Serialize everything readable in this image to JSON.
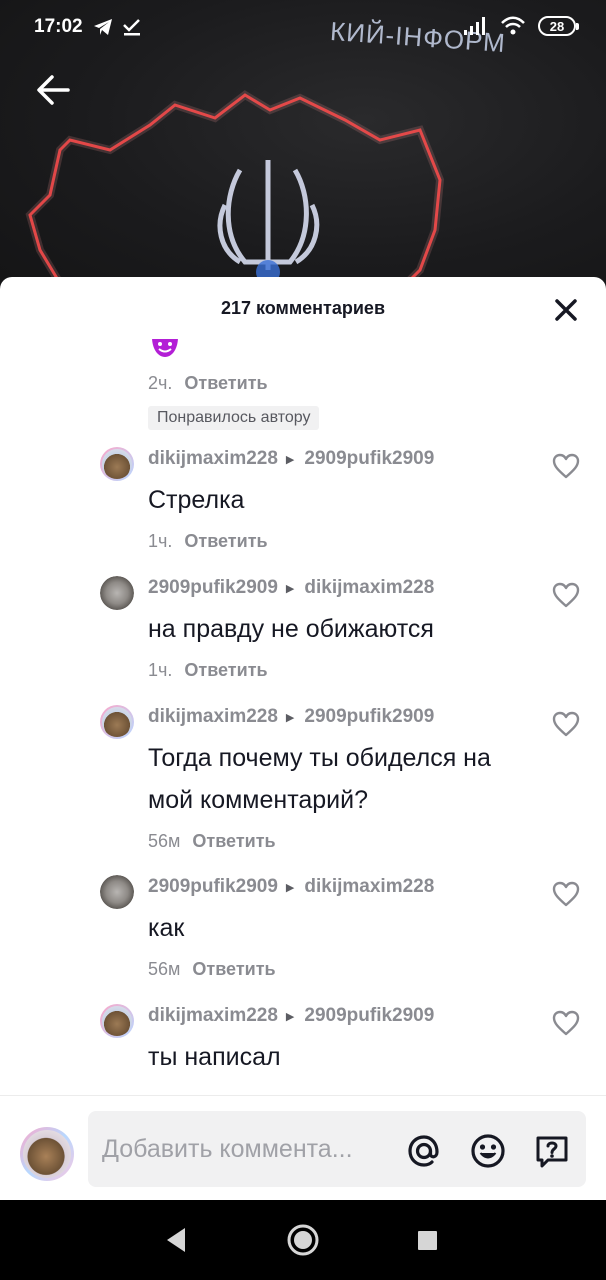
{
  "status_bar": {
    "time": "17:02",
    "battery": "28"
  },
  "video": {
    "overlay_text": "КИЙ-ІНФОРМ"
  },
  "sheet": {
    "title": "217 комментариев"
  },
  "first_meta": {
    "time": "2ч.",
    "reply_label": "Ответить",
    "liked_badge": "Понравилось автору"
  },
  "comments": [
    {
      "user": "dikijmaxim228",
      "reply_to": "2909pufik2909",
      "text": "Стрелка",
      "time": "1ч.",
      "reply_label": "Ответить"
    },
    {
      "user": "2909pufik2909",
      "reply_to": "dikijmaxim228",
      "text": "на правду не обижаются",
      "time": "1ч.",
      "reply_label": "Ответить"
    },
    {
      "user": "dikijmaxim228",
      "reply_to": "2909pufik2909",
      "text": "Тогда почему ты обиделся на мой комментарий?",
      "time": "56м",
      "reply_label": "Ответить"
    },
    {
      "user": "2909pufik2909",
      "reply_to": "dikijmaxim228",
      "text": "как",
      "time": "56м",
      "reply_label": "Ответить"
    },
    {
      "user": "dikijmaxim228",
      "reply_to": "2909pufik2909",
      "text": "ты написал",
      "time": "",
      "reply_label": ""
    }
  ],
  "input": {
    "placeholder": "Добавить коммента..."
  },
  "icons": {
    "back": "arrow-left-icon",
    "close": "close-icon",
    "like": "heart-outline-icon",
    "mention": "at-icon",
    "emoji": "smiley-icon",
    "question": "question-bubble-icon"
  },
  "colors": {
    "accent_text": "#161823",
    "secondary_text": "#8a8b91",
    "sheet_bg": "#ffffff",
    "input_bg": "#f1f1f2"
  }
}
